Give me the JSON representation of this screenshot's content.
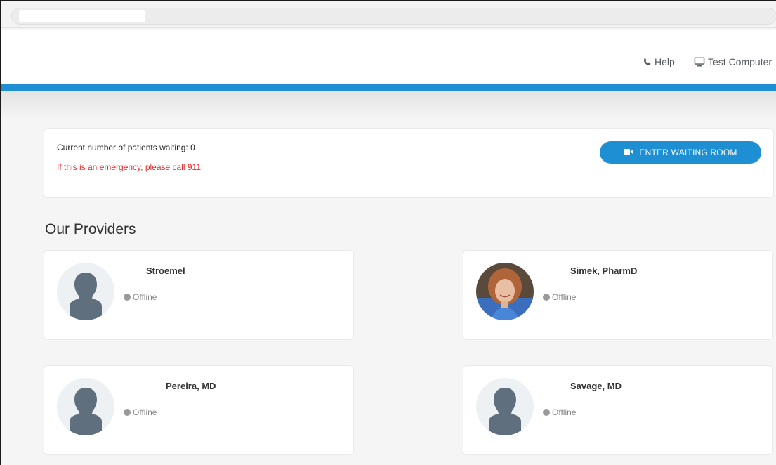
{
  "header": {
    "help_label": "Help",
    "test_computer_label": "Test Computer"
  },
  "waiting": {
    "count_text": "Current number of patients waiting: 0",
    "emergency_text": "If this is an emergency, please call 911",
    "enter_button_label": "ENTER WAITING ROOM"
  },
  "providers_title": "Our Providers",
  "providers": [
    {
      "name": "Stroemel",
      "status": "Offline",
      "avatar": "placeholder-avatar"
    },
    {
      "name": "Simek, PharmD",
      "status": "Offline",
      "avatar": "photo-avatar"
    },
    {
      "name": "Pereira, MD",
      "status": "Offline",
      "avatar": "placeholder-avatar"
    },
    {
      "name": "Savage, MD",
      "status": "Offline",
      "avatar": "placeholder-avatar"
    }
  ],
  "colors": {
    "accent_blue": "#1e8fd3",
    "emergency_red": "#e8282b",
    "offline_gray": "#9a9a9a",
    "avatar_silhouette": "#5f6f7e"
  },
  "icons": {
    "help": "phone-icon",
    "test_computer": "monitor-icon",
    "enter_button": "video-camera-icon",
    "status": "status-dot-icon"
  }
}
